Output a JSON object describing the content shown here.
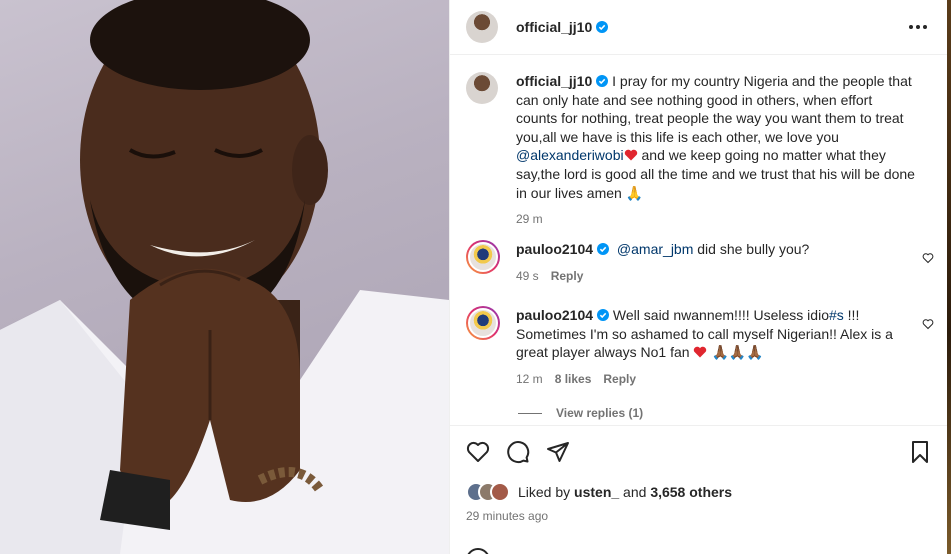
{
  "post": {
    "author": "official_jj10",
    "caption_author": "official_jj10",
    "caption_part1": "I pray for my country Nigeria and the people that can only hate and see nothing good in others, when effort counts for nothing, treat people the way you want them to treat you,all we have is this life is each other, we love you ",
    "caption_mention": "@alexanderiwobi",
    "caption_part2": " and we keep going no matter what they say,the lord is good all the time and we trust that his will be done in our lives amen ",
    "caption_emoji": "🙏",
    "caption_time": "29 m"
  },
  "comments": [
    {
      "user": "pauloo2104",
      "mention": "@amar_jbm",
      "text": " did she bully you?",
      "time": "49 s",
      "reply": "Reply"
    },
    {
      "user": "pauloo2104",
      "text_part1": " Well said nwannem!!!! Useless idio",
      "hashtag": "#s",
      "text_part2": " !!! Sometimes I'm so ashamed to call myself Nigerian!! Alex is a great player always No1 fan ",
      "emojis": "🙏🏾🙏🏾🙏🏾",
      "time": "12 m",
      "likes": "8 likes",
      "reply": "Reply"
    }
  ],
  "view_replies": "View replies (1)",
  "likes": {
    "prefix": "Liked by ",
    "user": "usten_",
    "middle": " and ",
    "count": "3,658 others"
  },
  "posted": "29 minutes ago",
  "icons": {
    "like": "heart-icon",
    "comment": "comment-icon",
    "share": "share-icon",
    "save": "bookmark-icon",
    "more": "more-icon",
    "verified": "verified-badge-icon"
  },
  "colors": {
    "verified": "#0095f6",
    "heart": "#ed1c24",
    "link": "#00376b",
    "meta": "#737373"
  }
}
